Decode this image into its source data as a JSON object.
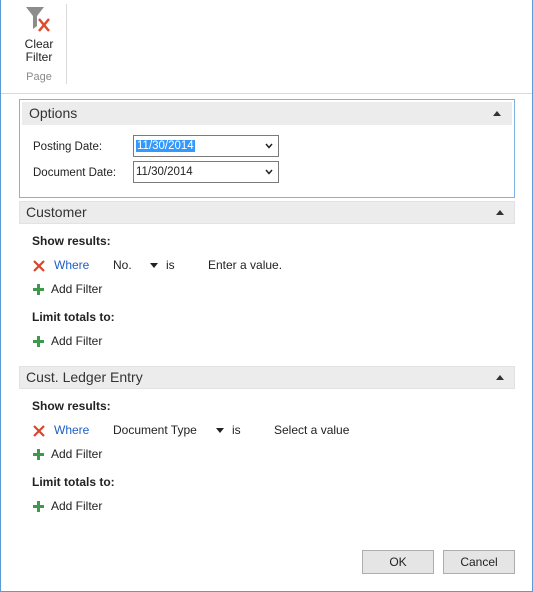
{
  "ribbon": {
    "clear_filter_label_line1": "Clear",
    "clear_filter_label_line2": "Filter",
    "group_label": "Page"
  },
  "options": {
    "title": "Options",
    "posting_date_label": "Posting Date:",
    "posting_date_value": "11/30/2014",
    "document_date_label": "Document Date:",
    "document_date_value": "11/30/2014"
  },
  "customer": {
    "title": "Customer",
    "show_results_label": "Show results:",
    "filter": {
      "where": "Where",
      "field": "No.",
      "operator": "is",
      "value_placeholder": "Enter a value."
    },
    "add_filter_label": "Add Filter",
    "limit_totals_label": "Limit totals to:",
    "limit_add_filter_label": "Add Filter"
  },
  "ledger": {
    "title": "Cust. Ledger Entry",
    "show_results_label": "Show results:",
    "filter": {
      "where": "Where",
      "field": "Document Type",
      "operator": "is",
      "value_placeholder": "Select a value"
    },
    "add_filter_label": "Add Filter",
    "limit_totals_label": "Limit totals to:",
    "limit_add_filter_label": "Add Filter"
  },
  "buttons": {
    "ok": "OK",
    "cancel": "Cancel"
  }
}
